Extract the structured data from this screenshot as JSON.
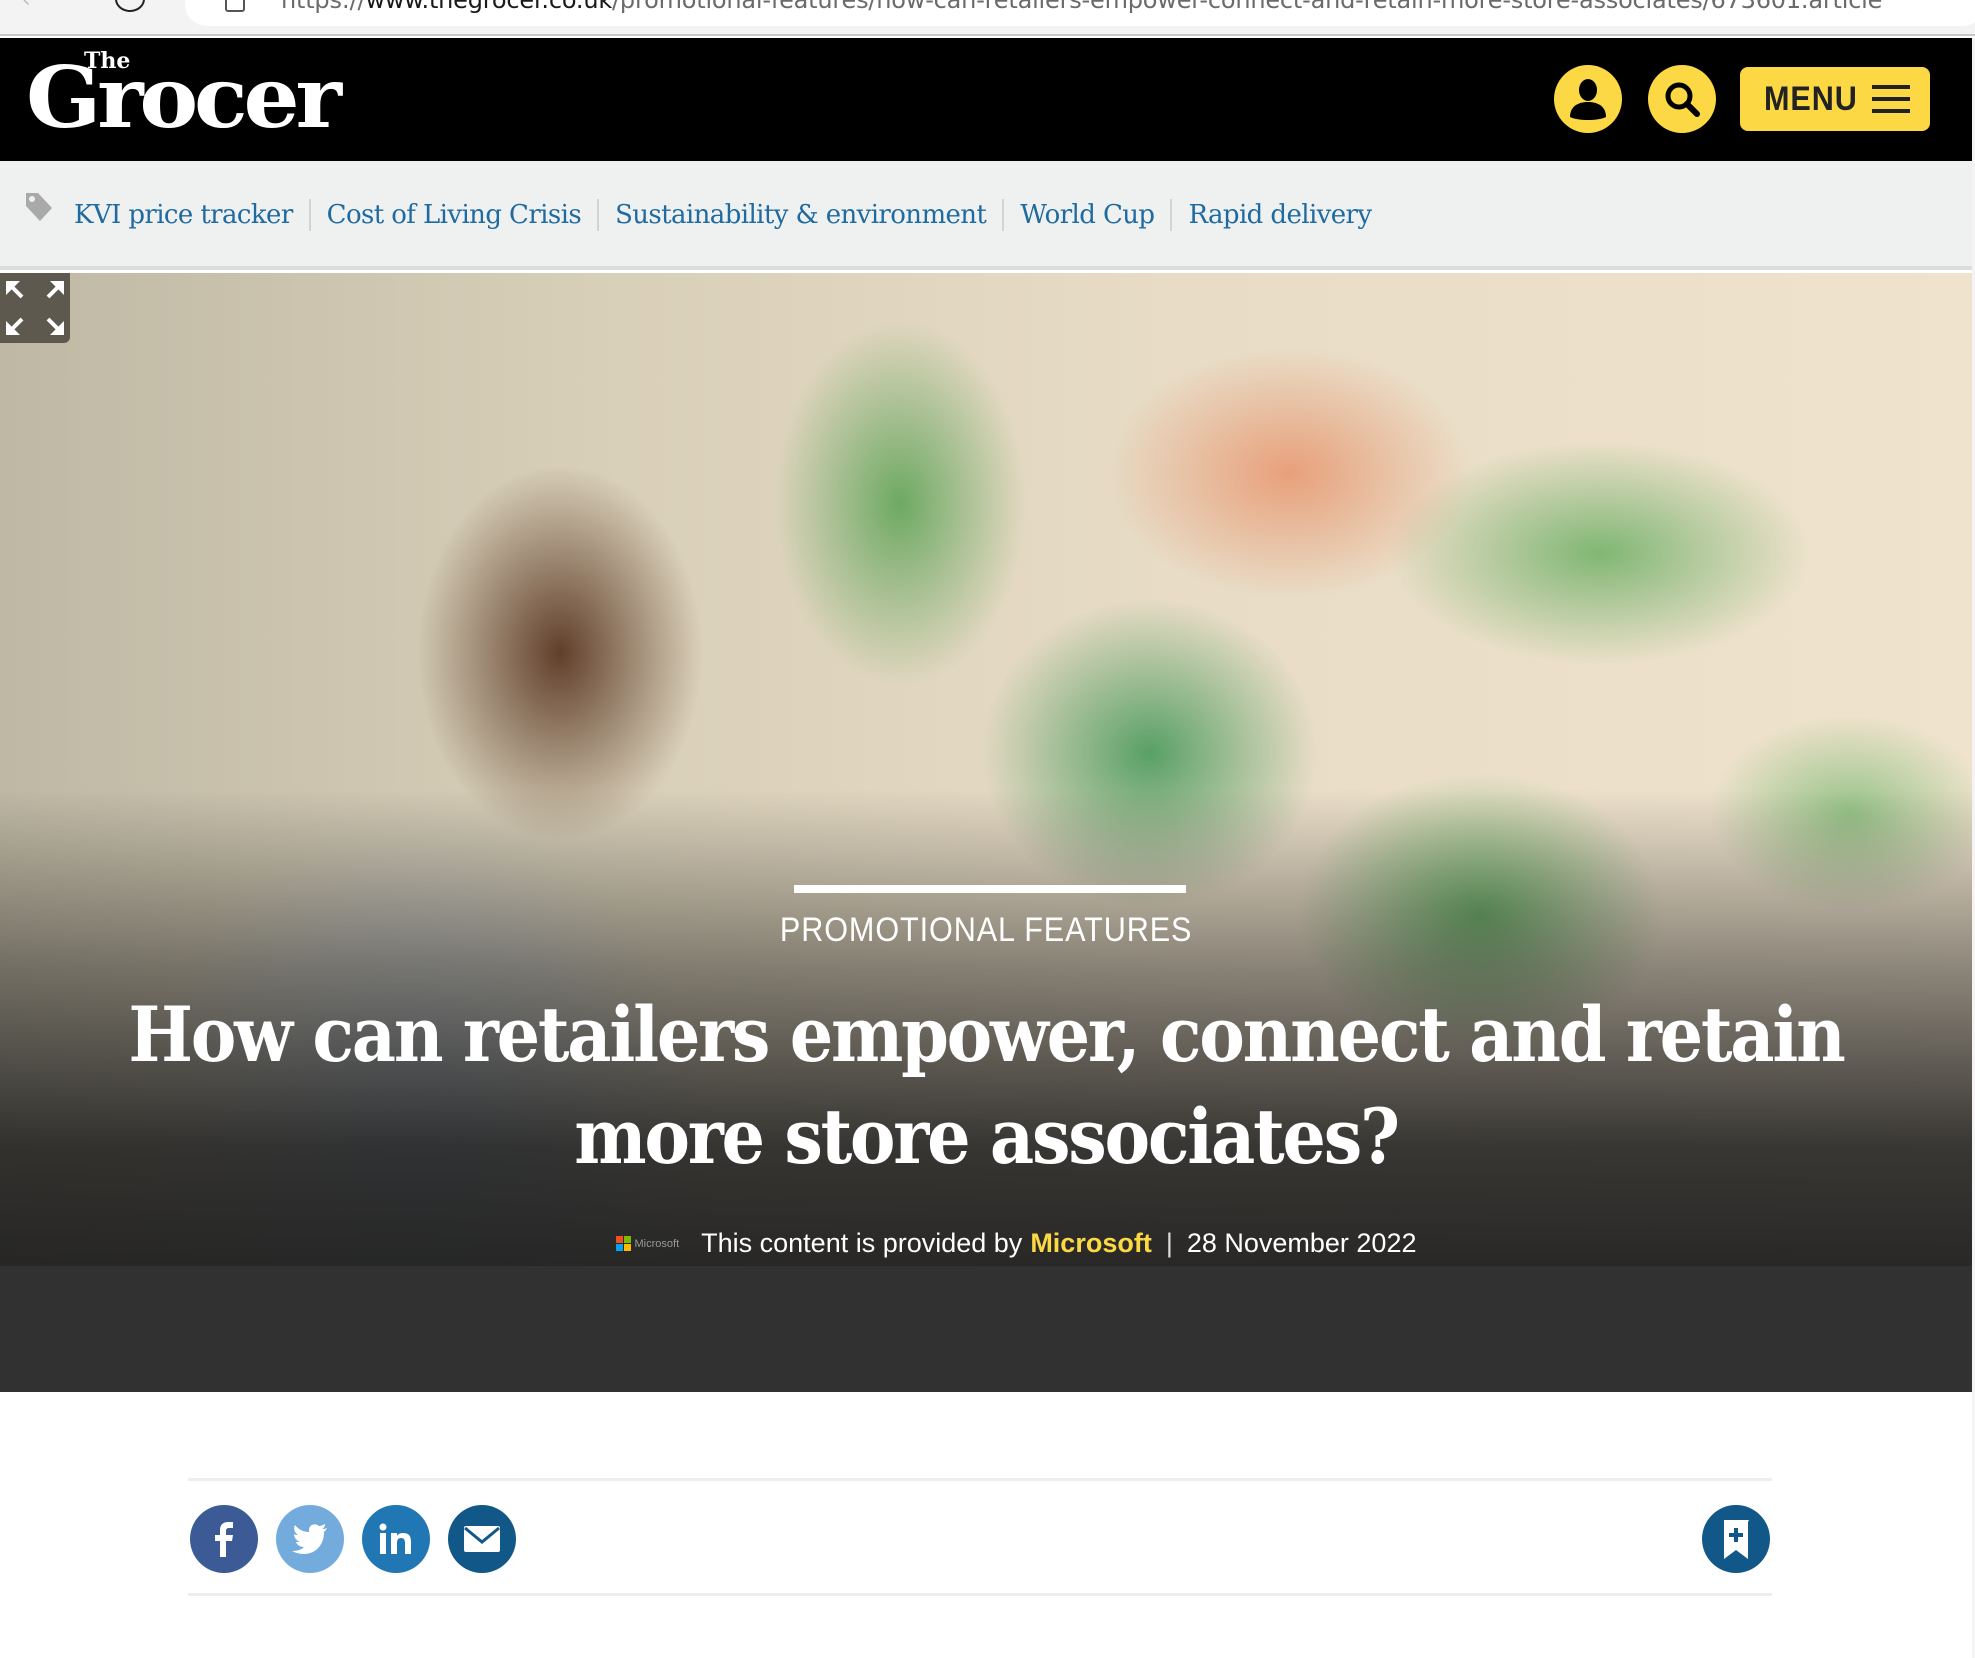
{
  "browser": {
    "url_scheme": "https://",
    "url_host": "www.thegrocer.co.uk",
    "url_path": "/promotional-features/how-can-retailers-empower-connect-and-retain-more-store-associates/673601.article"
  },
  "header": {
    "logo_small": "The",
    "logo_main": "Grocer",
    "account_icon": "user-account-icon",
    "search_icon": "search-icon",
    "menu_label": "MENU",
    "menu_icon": "hamburger-icon",
    "accent_color": "#fcd944"
  },
  "tags": {
    "icon": "tag-icon",
    "items": [
      {
        "label": "KVI price tracker"
      },
      {
        "label": "Cost of Living Crisis"
      },
      {
        "label": "Sustainability & environment"
      },
      {
        "label": "World Cup"
      },
      {
        "label": "Rapid delivery"
      }
    ],
    "link_color": "#1f6aa0"
  },
  "hero": {
    "expand_icon": "expand-icon",
    "section": "PROMOTIONAL FEATURES",
    "headline": "How can retailers empower, connect and retain more store associates?",
    "byline_logo_text": "Microsoft",
    "byline_prefix": "This content is provided by",
    "byline_sponsor": "Microsoft",
    "byline_separator": "|",
    "date": "28 November 2022"
  },
  "share": {
    "buttons": [
      {
        "name": "facebook",
        "icon": "facebook-icon",
        "color": "#3c5a96"
      },
      {
        "name": "twitter",
        "icon": "twitter-icon",
        "color": "#73acdc"
      },
      {
        "name": "linkedin",
        "icon": "linkedin-icon",
        "color": "#2077b4"
      },
      {
        "name": "email",
        "icon": "email-icon",
        "color": "#115889"
      }
    ],
    "save_icon": "bookmark-add-icon"
  }
}
